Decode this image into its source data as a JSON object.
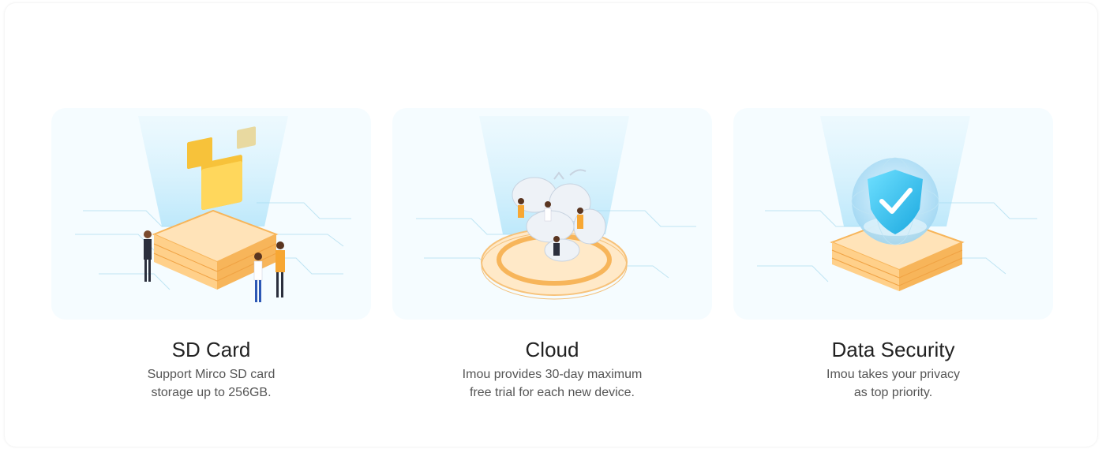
{
  "features": [
    {
      "title": "SD Card",
      "description_lines": [
        "Support Mirco SD card",
        "storage up to 256GB."
      ],
      "illustration_icon": "sd-card-folders-illustration"
    },
    {
      "title": "Cloud",
      "description_lines": [
        "Imou provides 30-day maximum",
        "free trial for each new device."
      ],
      "illustration_icon": "cloud-storage-illustration"
    },
    {
      "title": "Data Security",
      "description_lines": [
        "Imou takes your privacy",
        "as top priority."
      ],
      "illustration_icon": "shield-security-illustration"
    }
  ],
  "colors": {
    "card_bg": "#f5fcff",
    "beam": "#bfe9fb",
    "platform": "#ffd79b",
    "platform_dark": "#f7b55a",
    "folder": "#f7c23a",
    "shield": "#2ec4ef",
    "title_text": "#222222",
    "desc_text": "#555555"
  }
}
